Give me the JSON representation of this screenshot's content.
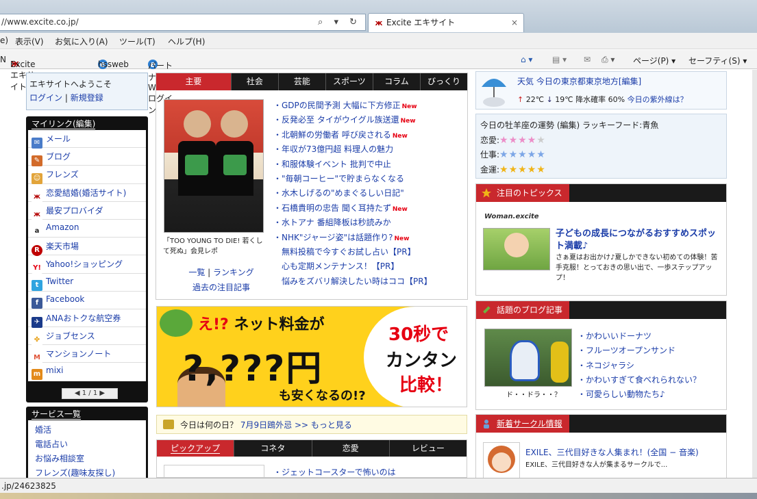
{
  "browser": {
    "address": "//www.excite.co.jp/",
    "address_buttons": "⌕ ▾ ↻",
    "tab_title": "Excite エキサイト",
    "tab_close": "×",
    "menu": [
      "e)",
      "表示(V)",
      "お気に入り(A)",
      "ツール(T)",
      "ヘルプ(H)"
    ],
    "favorites": [
      "N",
      "Excite エキサイト",
      "hssweb",
      "パートナーWEB★ログイン"
    ],
    "right_tools": [
      "⌂ ▾",
      "▤ ▾",
      "✉",
      "⎙ ▾",
      "ページ(P) ▾",
      "セーフティ(S) ▾"
    ],
    "status_url": ".jp/24623825"
  },
  "welcome": {
    "greeting": "エキサイトへようこそ",
    "login": "ログイン",
    "register": "新規登録"
  },
  "mylinks": {
    "title": "マイリンク(編集)",
    "items": [
      {
        "label": "メール",
        "icon": "mail-icon",
        "color": "#4a7cc9"
      },
      {
        "label": "ブログ",
        "icon": "blog-icon",
        "color": "#d26b2a"
      },
      {
        "label": "フレンズ",
        "icon": "friends-icon",
        "color": "#e2a43a"
      },
      {
        "label": "恋愛結婚(婚活サイト)",
        "icon": "excite-icon",
        "color": "#b30000"
      },
      {
        "label": "最安プロバイダ",
        "icon": "excite-icon",
        "color": "#b30000"
      },
      {
        "label": "Amazon",
        "icon": "amazon-icon",
        "color": "#222222"
      },
      {
        "label": "楽天市場",
        "icon": "rakuten-icon",
        "color": "#bf0000"
      },
      {
        "label": "Yahoo!ショッピング",
        "icon": "yahoo-icon",
        "color": "#e60012"
      },
      {
        "label": "Twitter",
        "icon": "twitter-icon",
        "color": "#2fa4e0"
      },
      {
        "label": "Facebook",
        "icon": "facebook-icon",
        "color": "#3b5998"
      },
      {
        "label": "ANAおトクな航空券",
        "icon": "ana-icon",
        "color": "#1a3a8a"
      },
      {
        "label": "ジョブセンス",
        "icon": "jobsense-icon",
        "color": "#e8a21a"
      },
      {
        "label": "マンションノート",
        "icon": "mansion-icon",
        "color": "#e0553a"
      },
      {
        "label": "mixi",
        "icon": "mixi-icon",
        "color": "#e38a1a"
      }
    ],
    "pager": "◀ 1 / 1 ▶"
  },
  "services": {
    "title": "サービス一覧",
    "items": [
      "婚活",
      "電話占い",
      "お悩み相談室",
      "フレンズ(趣味友探し)"
    ]
  },
  "news": {
    "tabs": [
      "主要",
      "社会",
      "芸能",
      "スポーツ",
      "コラム",
      "びっくり"
    ],
    "photo_caption": "「TOO YOUNG TO DIE! 若くして死ぬ」会見レポ",
    "link_list": "一覧",
    "link_ranking": "ランキング",
    "link_past": "過去の注目記事",
    "new_label": "New",
    "headlines": [
      {
        "text": "・GDPの民間予測 大幅に下方修正",
        "new": true
      },
      {
        "text": "・反発必至 タイがウイグル族送還",
        "new": true
      },
      {
        "text": "・北朝鮮の労働者 呼び戻される",
        "new": true
      },
      {
        "text": "・年収が73億円超 料理人の魅力",
        "new": false
      },
      {
        "text": "・和服体験イベント 批判で中止",
        "new": false
      },
      {
        "text": "・\"毎朝コーヒー\"で貯まらなくなる",
        "new": false
      },
      {
        "text": "・水木しげるの\"めまぐるしい日記\"",
        "new": false
      },
      {
        "text": "・石橋貴明の忠告 聞く耳持たず",
        "new": true
      },
      {
        "text": "・水トアナ 番組降板は秒読みか",
        "new": false
      },
      {
        "text": "・NHK\"ジャージ姿\"は話題作り?",
        "new": true
      },
      {
        "text": "　無料投稿で今すぐお試し占い【PR】",
        "new": false
      },
      {
        "text": "　心も定期メンテナンス！【PR】",
        "new": false
      },
      {
        "text": "　悩みをズバリ解決したい時はココ【PR】",
        "new": false
      }
    ]
  },
  "banner": {
    "line1_a": "え!?",
    "line1_b": "ネット料金が",
    "question": "?,???円",
    "line3": "も安くなるの!?",
    "side1": "30秒で",
    "side2": "カンタン",
    "side3": "比較！"
  },
  "today": {
    "label": "今日は何の日？",
    "event": "7月9日鴎外忌",
    "more": ">> もっと見る"
  },
  "pickup": {
    "tabs": [
      "ピックアップ",
      "コネタ",
      "恋愛",
      "レビュー"
    ],
    "headline": "・ジェットコースターで怖いのは"
  },
  "weather": {
    "label": "天気",
    "location": "今日の東京都東京地方",
    "edit": "[編集]",
    "high_arrow": "↑",
    "high": "22℃",
    "low_arrow": "↓",
    "low": "19℃",
    "rain": "降水確率 60%",
    "uv": "今日の紫外線は？"
  },
  "fortune": {
    "title": "今日の牡羊座の運勢 (編集) ラッキーフード:",
    "food": "青魚",
    "love_label": "恋愛:",
    "love_stars": "★★★★★",
    "love_rating": 4,
    "work_label": "仕事:",
    "work_stars": "★★★★★",
    "work_rating": 5,
    "money_label": "金運:",
    "money_stars": "★★★★★",
    "money_rating": 5
  },
  "topics": {
    "title": "注目のトピックス",
    "brand": "Woman.excite",
    "headline": "子どもの成長につながるおすすめスポット満載♪",
    "desc": "さぁ夏はお出かけ♪夏しかできない初めての体験！苦手克服！とっておきの思い出で、一歩ステップアップ！"
  },
  "blog": {
    "title": "話題のブログ記事",
    "caption": "ド・・ドラ・・？",
    "items": [
      "・かわいいドーナツ",
      "・フルーツオープンサンド",
      "・ネコジャラシ",
      "・かわいすぎて食べれられない？",
      "・可愛らしい動物たち♪"
    ]
  },
  "circle": {
    "title": "新着サークル情報",
    "headline": "EXILE、三代目好きな人集まれ！(全国 − 音楽)",
    "desc": "EXILE、三代目好きな人が集まるサークルで..."
  }
}
